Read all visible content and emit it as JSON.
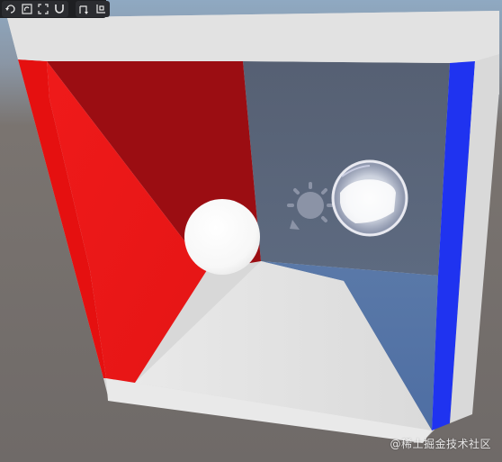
{
  "toolbar": {
    "groups": [
      {
        "tools": [
          "move-tool",
          "rotate-tool",
          "scale-tool",
          "magnet-tool"
        ]
      },
      {
        "tools": [
          "local-pivot-tool",
          "global-pivot-tool"
        ]
      }
    ]
  },
  "scene": {
    "objects": [
      "left-wall",
      "right-wall",
      "back-wall",
      "ceiling",
      "floor",
      "white-sphere",
      "glass-sphere",
      "light-gizmo"
    ],
    "colors": {
      "left_wall": "#e81212",
      "right_wall": "#1f33f0",
      "back_wall": "#5a6174",
      "ceiling": "#e2e2e2",
      "floor": "#e4e4e4"
    }
  },
  "watermark": {
    "text": "@稀土掘金技术社区"
  }
}
